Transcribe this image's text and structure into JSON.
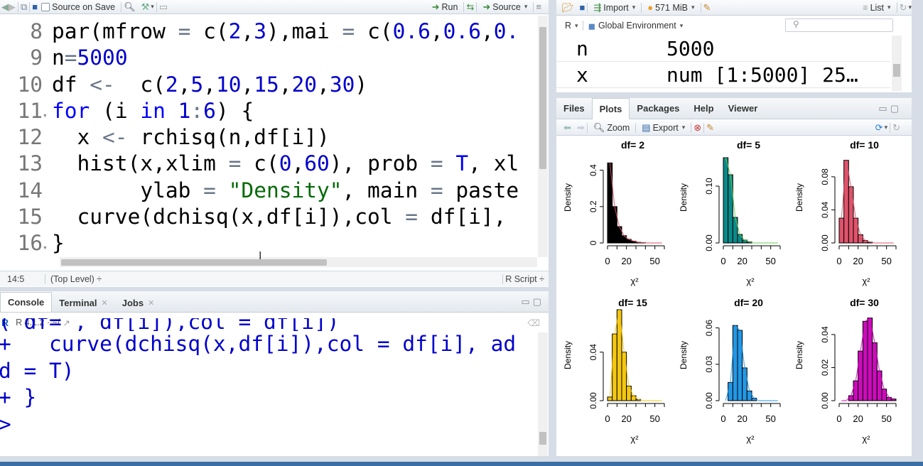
{
  "editor": {
    "toolbar": {
      "source_on_save": "Source on Save",
      "run": "Run",
      "source": "Source"
    },
    "lines": [
      {
        "num": "8",
        "segments": [
          [
            "t",
            "par(mfrow "
          ],
          [
            "o",
            "="
          ],
          [
            "t",
            " c("
          ],
          [
            "n",
            "2"
          ],
          [
            "t",
            ","
          ],
          [
            "n",
            "3"
          ],
          [
            "t",
            "),mai "
          ],
          [
            "o",
            "="
          ],
          [
            "t",
            " c("
          ],
          [
            "n",
            "0.6"
          ],
          [
            "t",
            ","
          ],
          [
            "n",
            "0.6"
          ],
          [
            "t",
            ","
          ],
          [
            "n",
            "0."
          ]
        ]
      },
      {
        "num": "9",
        "segments": [
          [
            "t",
            "n"
          ],
          [
            "o",
            "="
          ],
          [
            "n",
            "5000"
          ]
        ]
      },
      {
        "num": "10",
        "segments": [
          [
            "t",
            "df "
          ],
          [
            "o",
            "<-"
          ],
          [
            "t",
            "  c("
          ],
          [
            "n",
            "2"
          ],
          [
            "t",
            ","
          ],
          [
            "n",
            "5"
          ],
          [
            "t",
            ","
          ],
          [
            "n",
            "10"
          ],
          [
            "t",
            ","
          ],
          [
            "n",
            "15"
          ],
          [
            "t",
            ","
          ],
          [
            "n",
            "20"
          ],
          [
            "t",
            ","
          ],
          [
            "n",
            "30"
          ],
          [
            "t",
            ")"
          ]
        ]
      },
      {
        "num": "11",
        "fold": true,
        "segments": [
          [
            "k",
            "for"
          ],
          [
            "t",
            " (i "
          ],
          [
            "k",
            "in"
          ],
          [
            "t",
            " "
          ],
          [
            "n",
            "1"
          ],
          [
            "o",
            ":"
          ],
          [
            "n",
            "6"
          ],
          [
            "t",
            ") {"
          ]
        ]
      },
      {
        "num": "12",
        "segments": [
          [
            "t",
            "  x "
          ],
          [
            "o",
            "<-"
          ],
          [
            "t",
            " rchisq(n,df[i])"
          ]
        ]
      },
      {
        "num": "13",
        "segments": [
          [
            "t",
            "  hist(x,xlim "
          ],
          [
            "o",
            "="
          ],
          [
            "t",
            " c("
          ],
          [
            "n",
            "0"
          ],
          [
            "t",
            ","
          ],
          [
            "n",
            "60"
          ],
          [
            "t",
            "), prob "
          ],
          [
            "o",
            "="
          ],
          [
            "t",
            " "
          ],
          [
            "k",
            "T"
          ],
          [
            "t",
            ", xl"
          ]
        ]
      },
      {
        "num": "14",
        "segments": [
          [
            "t",
            "       ylab "
          ],
          [
            "o",
            "="
          ],
          [
            "t",
            " "
          ],
          [
            "s",
            "\"Density\""
          ],
          [
            "t",
            ", main "
          ],
          [
            "o",
            "="
          ],
          [
            "t",
            " paste"
          ]
        ]
      },
      {
        "num": "15",
        "segments": [
          [
            "t",
            "  curve(dchisq(x,df[i]),col "
          ],
          [
            "o",
            "="
          ],
          [
            "t",
            " df[i],"
          ]
        ]
      },
      {
        "num": "16",
        "fold": true,
        "segments": [
          [
            "t",
            "}"
          ]
        ]
      }
    ],
    "status": {
      "position": "14:5",
      "scope": "(Top Level) ÷",
      "filetype": "R Script ÷"
    }
  },
  "console": {
    "tabs": [
      "Console",
      "Terminal",
      "Jobs"
    ],
    "version": "R 4.1.2 · ~/",
    "lines": [
      "( df= , df[i]),col = df[i])",
      "+   curve(dchisq(x,df[i]),col = df[i], ad",
      "d = T)",
      "+ }",
      "> "
    ]
  },
  "environment": {
    "toolbar": {
      "import": "Import",
      "memory": "571 MiB",
      "view": "List"
    },
    "lang": "R",
    "scope": "Global Environment",
    "rows": [
      {
        "name": "n",
        "value": "5000"
      },
      {
        "name": "x",
        "value": "num [1:5000] 25…"
      }
    ]
  },
  "plots_pane": {
    "tabs": [
      "Files",
      "Plots",
      "Packages",
      "Help",
      "Viewer"
    ],
    "toolbar": {
      "zoom": "Zoom",
      "export": "Export"
    }
  },
  "chart_data": [
    {
      "type": "bar",
      "title": "df= 2",
      "ylabel": "Density",
      "xlabel": "χ²",
      "xlim": [
        0,
        60
      ],
      "yticks": [
        "0",
        "0.2",
        "0.4"
      ],
      "ymax": 0.5,
      "xticks": [
        "0",
        "20",
        "50"
      ],
      "color": "#000000",
      "curve_color": "#df536b",
      "values": [
        0.44,
        0.2,
        0.09,
        0.04,
        0.02,
        0.01,
        0.004,
        0.002,
        0,
        0,
        0,
        0
      ]
    },
    {
      "type": "bar",
      "title": "df= 5",
      "ylabel": "Density",
      "xlabel": "χ²",
      "xlim": [
        0,
        60
      ],
      "yticks": [
        "0.00",
        "0.10"
      ],
      "ymax": 0.16,
      "xticks": [
        "0",
        "20",
        "50"
      ],
      "color": "#2297e6",
      "curve_color": "#61d04f",
      "fill": "#0a8a8a",
      "values": [
        0.15,
        0.12,
        0.045,
        0.015,
        0.005,
        0.002,
        0,
        0,
        0,
        0,
        0,
        0
      ]
    },
    {
      "type": "bar",
      "title": "df= 10",
      "ylabel": "Density",
      "xlabel": "χ²",
      "xlim": [
        0,
        60
      ],
      "yticks": [
        "0.00",
        "0.04",
        "0.08"
      ],
      "ymax": 0.11,
      "xticks": [
        "0",
        "20",
        "50"
      ],
      "color": "#df536b",
      "values": [
        0.03,
        0.1,
        0.068,
        0.03,
        0.01,
        0.003,
        0.001,
        0,
        0,
        0,
        0,
        0
      ]
    },
    {
      "type": "bar",
      "title": "df= 15",
      "ylabel": "Density",
      "xlabel": "χ²",
      "xlim": [
        0,
        60
      ],
      "yticks": [
        "0.00",
        "0.04"
      ],
      "ymax": 0.075,
      "xticks": [
        "0",
        "20",
        "50"
      ],
      "color": "#f5c710",
      "values": [
        0.003,
        0.055,
        0.075,
        0.04,
        0.012,
        0.004,
        0.001,
        0,
        0,
        0,
        0,
        0
      ]
    },
    {
      "type": "bar",
      "title": "df= 20",
      "ylabel": "Density",
      "xlabel": "χ²",
      "xlim": [
        0,
        60
      ],
      "yticks": [
        "0.00",
        "0.03",
        "0.06"
      ],
      "ymax": 0.075,
      "xticks": [
        "0",
        "20",
        "50"
      ],
      "color": "#2297e6",
      "values": [
        0,
        0.015,
        0.062,
        0.058,
        0.027,
        0.008,
        0.002,
        0,
        0,
        0,
        0,
        0
      ]
    },
    {
      "type": "bar",
      "title": "df= 30",
      "ylabel": "Density",
      "xlabel": "χ²",
      "xlim": [
        0,
        60
      ],
      "yticks": [
        "0.00",
        "0.02",
        "0.04"
      ],
      "ymax": 0.055,
      "xticks": [
        "0",
        "20",
        "50"
      ],
      "color": "#cd0bbc",
      "values": [
        0,
        0,
        0.003,
        0.012,
        0.03,
        0.048,
        0.05,
        0.035,
        0.018,
        0.007,
        0.002,
        0.001
      ]
    }
  ]
}
